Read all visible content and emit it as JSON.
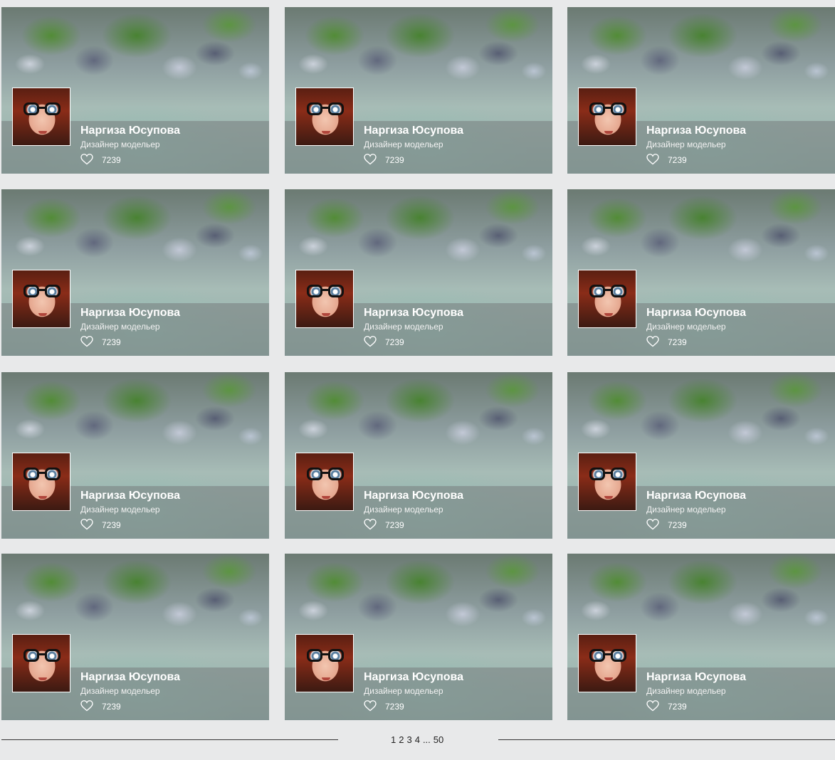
{
  "cards": [
    {
      "name": "Наргиза Юсупова",
      "role": "Дизайнер модельер",
      "likes": "7239",
      "heart_icon": "heart-outline-icon"
    },
    {
      "name": "Наргиза Юсупова",
      "role": "Дизайнер модельер",
      "likes": "7239",
      "heart_icon": "heart-outline-icon"
    },
    {
      "name": "Наргиза Юсупова",
      "role": "Дизайнер модельер",
      "likes": "7239",
      "heart_icon": "heart-outline-icon"
    },
    {
      "name": "Наргиза Юсупова",
      "role": "Дизайнер модельер",
      "likes": "7239",
      "heart_icon": "heart-outline-icon"
    },
    {
      "name": "Наргиза Юсупова",
      "role": "Дизайнер модельер",
      "likes": "7239",
      "heart_icon": "heart-outline-icon"
    },
    {
      "name": "Наргиза Юсупова",
      "role": "Дизайнер модельер",
      "likes": "7239",
      "heart_icon": "heart-outline-icon"
    },
    {
      "name": "Наргиза Юсупова",
      "role": "Дизайнер модельер",
      "likes": "7239",
      "heart_icon": "heart-outline-icon"
    },
    {
      "name": "Наргиза Юсупова",
      "role": "Дизайнер модельер",
      "likes": "7239",
      "heart_icon": "heart-outline-icon"
    },
    {
      "name": "Наргиза Юсупова",
      "role": "Дизайнер модельер",
      "likes": "7239",
      "heart_icon": "heart-outline-icon"
    },
    {
      "name": "Наргиза Юсупова",
      "role": "Дизайнер модельер",
      "likes": "7239",
      "heart_icon": "heart-outline-icon"
    },
    {
      "name": "Наргиза Юсупова",
      "role": "Дизайнер модельер",
      "likes": "7239",
      "heart_icon": "heart-outline-icon"
    },
    {
      "name": "Наргиза Юсупова",
      "role": "Дизайнер модельер",
      "likes": "7239",
      "heart_icon": "heart-outline-icon"
    }
  ],
  "pagination": {
    "pages": [
      "1",
      "2",
      "3",
      "4"
    ],
    "ellipsis": "...",
    "last": "50"
  },
  "colors": {
    "background": "#e8e9ea",
    "text_on_overlay": "#ffffff",
    "rule": "#333333"
  }
}
